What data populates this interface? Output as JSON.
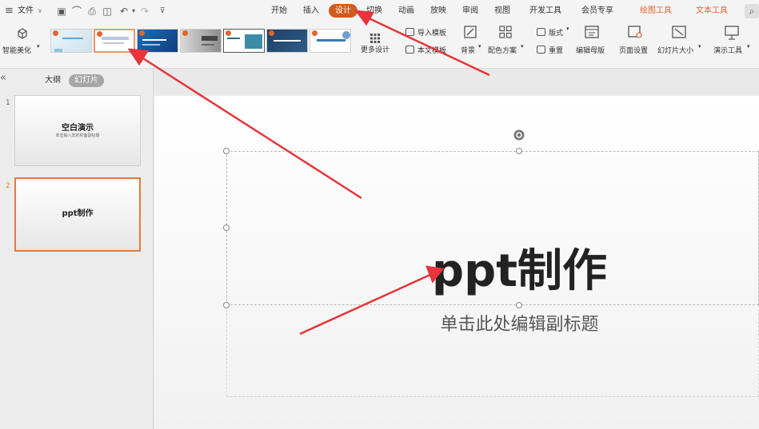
{
  "menubar": {
    "file_label": "文件",
    "tabs": [
      "开始",
      "插入",
      "设计",
      "切换",
      "动画",
      "放映",
      "审阅",
      "视图",
      "开发工具",
      "会员专享",
      "绘图工具",
      "文本工具"
    ],
    "active_tab": "设计",
    "contextual_tabs": [
      "绘图工具",
      "文本工具"
    ]
  },
  "ribbon": {
    "smart_beautify": "智能美化",
    "more_designs": "更多设计",
    "import_template": "导入模板",
    "this_template": "本文模板",
    "background": "背景",
    "color_scheme": "配色方案",
    "layout": "版式",
    "reset": "重置",
    "edit_master": "编辑母版",
    "page_setup": "页面设置",
    "slide_size": "幻灯片大小",
    "presentation_tools": "演示工具"
  },
  "panel": {
    "tab_outline": "大纲",
    "tab_slides": "幻灯片",
    "slides": [
      {
        "number": "1",
        "title": "空白演示",
        "subtitle": "单击输入您的封面副标题"
      },
      {
        "number": "2",
        "title": "ppt制作"
      }
    ]
  },
  "slide": {
    "title": "ppt制作",
    "subtitle_placeholder": "单击此处编辑副标题"
  },
  "colors": {
    "accent": "#d25a1d",
    "contextual_tab": "#e2652e",
    "annotation_arrow": "#e8343a"
  }
}
